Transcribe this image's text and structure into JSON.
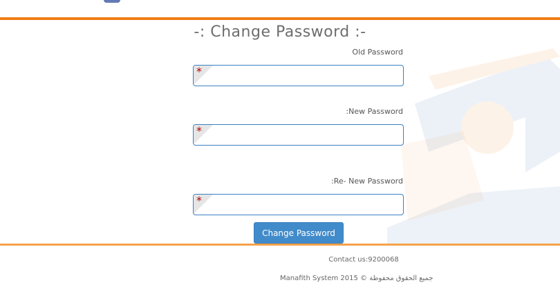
{
  "form": {
    "title": "-: Change Password :-",
    "fields": [
      {
        "label": "Old Password",
        "required_mark": "*",
        "value": ""
      },
      {
        "label": ":New Password",
        "required_mark": "*",
        "value": ""
      },
      {
        "label": ":Re- New Password",
        "required_mark": "*",
        "value": ""
      }
    ],
    "submit_label": "Change Password"
  },
  "footer": {
    "contact": "Contact us:9200068",
    "copyright": "Manafith System 2015 © جميع الحقوق محفوظة"
  },
  "colors": {
    "accent_orange": "#f07c14",
    "button_blue": "#428bca",
    "input_border": "#3b80c2",
    "required_red": "#b40000"
  }
}
